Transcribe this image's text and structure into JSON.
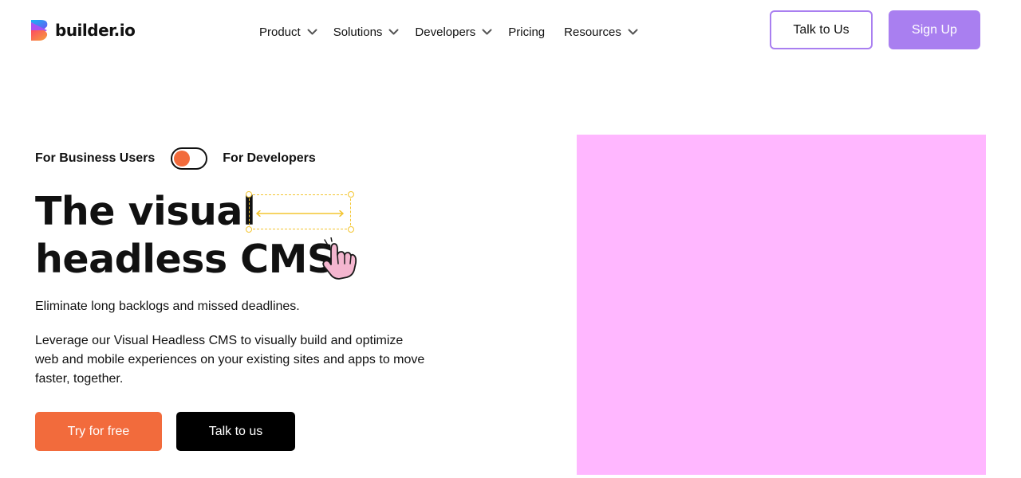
{
  "header": {
    "logo_text": "builder.io",
    "nav": [
      {
        "label": "Product",
        "has_dropdown": true
      },
      {
        "label": "Solutions",
        "has_dropdown": true
      },
      {
        "label": "Developers",
        "has_dropdown": true
      },
      {
        "label": "Pricing",
        "has_dropdown": false
      },
      {
        "label": "Resources",
        "has_dropdown": true
      }
    ],
    "talk_label": "Talk to Us",
    "signup_label": "Sign Up"
  },
  "hero": {
    "toggle": {
      "left_label": "For Business Users",
      "right_label": "For Developers",
      "state": "business"
    },
    "headline_line1": "The visual",
    "headline_line2": "headless CMS",
    "subhead": "Eliminate long backlogs and missed deadlines.",
    "paragraph": "Leverage our Visual Headless CMS to visually build and optimize web and mobile experiences on your existing sites and apps to move faster, together.",
    "cta_primary": "Try for free",
    "cta_secondary": "Talk to us"
  },
  "colors": {
    "brand_purple": "#a97ff0",
    "brand_orange": "#f26b3c",
    "media_panel": "#ffb7ff",
    "selection_yellow": "#f3c531",
    "hand_pink": "#f4b6cf"
  },
  "icons": {
    "logo": "builder-logo-icon",
    "dropdown": "chevron-down-icon",
    "hand": "pointer-hand-icon",
    "resize": "double-arrow-icon"
  }
}
